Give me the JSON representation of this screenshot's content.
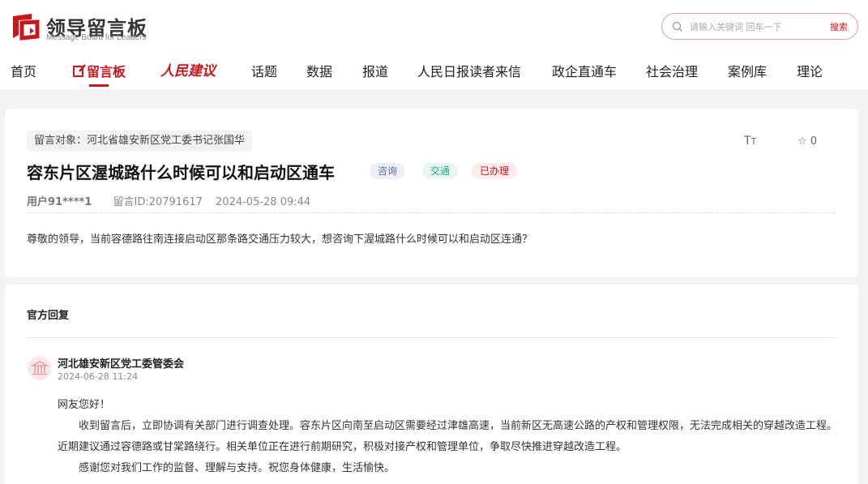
{
  "header": {
    "logo_title": "领导留言板",
    "logo_subtitle": "Message Board for Leaders",
    "search_placeholder": "请输入关键词 回车一下",
    "search_button": "搜索",
    "brand_color": "#c8161d"
  },
  "nav": {
    "items": [
      {
        "label": "首页"
      },
      {
        "label": "留言板"
      },
      {
        "label": "人民建议"
      },
      {
        "label": "话题"
      },
      {
        "label": "数据"
      },
      {
        "label": "报道"
      },
      {
        "label": "人民日报读者来信"
      },
      {
        "label": "政企直通车"
      },
      {
        "label": "社会治理"
      },
      {
        "label": "案例库"
      },
      {
        "label": "理论"
      }
    ],
    "active": "留言板"
  },
  "message": {
    "target": "留言对象：河北省雄安新区党工委书记张国华",
    "title": "容东片区渥城路什么时候可以和启动区通车",
    "tags": [
      "咨询",
      "交通",
      "已办理"
    ],
    "font_size_icon": "text-size-icon",
    "favorites": "0",
    "user": "用户91****1",
    "message_id": "留言ID:20791617",
    "time": "2024-05-28 09:44",
    "content": "尊敬的领导，当前容德路往南连接启动区那条路交通压力较大，想咨询下渥城路什么时候可以和启动区连通？"
  },
  "reply": {
    "heading": "官方回复",
    "org_name": "河北雄安新区党工委管委会",
    "time": "2024-06-28 11:24",
    "greeting": "网友您好！",
    "paragraph1": "收到留言后，立即协调有关部门进行调查处理。容东片区向南至启动区需要经过津雄高速，当前新区无高速公路的产权和管理权限，无法完成相关的穿越改造工程。近期建议通过容德路或甘棠路绕行。相关单位正在进行前期研究，积极对接产权和管理单位，争取尽快推进穿越改造工程。",
    "paragraph2": "感谢您对我们工作的监督、理解与支持。祝您身体健康，生活愉快。"
  }
}
